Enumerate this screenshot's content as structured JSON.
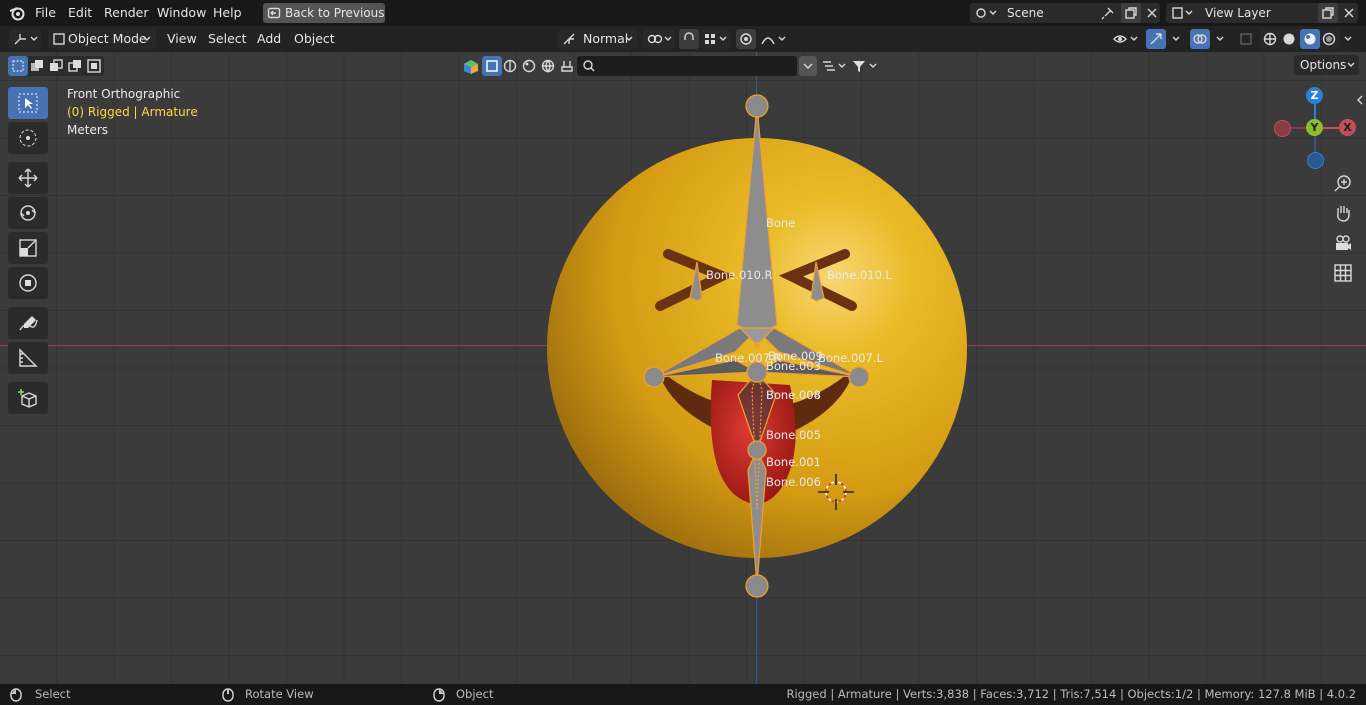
{
  "menu": {
    "file": "File",
    "edit": "Edit",
    "render": "Render",
    "window": "Window",
    "help": "Help",
    "back": "Back to Previous"
  },
  "scene": {
    "name": "Scene"
  },
  "view_layer": {
    "name": "View Layer"
  },
  "header": {
    "mode": "Object Mode",
    "view": "View",
    "select": "Select",
    "add": "Add",
    "object": "Object",
    "orientation": "Normal"
  },
  "overlay": {
    "view_name": "Front Orthographic",
    "collection": "(0) Rigged | Armature",
    "units": "Meters"
  },
  "options_label": "Options",
  "search": {
    "placeholder": ""
  },
  "bones": {
    "bone": "Bone",
    "b010r": "Bone.010.R",
    "b010l": "Bone.010.L",
    "b007r": "Bone.007.R",
    "b009": "Bone.009",
    "b003": "Bone.003",
    "b007l": "Bone.007.L",
    "b008": "Bone.008",
    "b004": "Bone.004",
    "b005": "Bone.005",
    "b001": "Bone.001",
    "b006": "Bone.006"
  },
  "gizmo": {
    "z": "Z",
    "y": "Y",
    "x": "X"
  },
  "status": {
    "select": "Select",
    "rotate": "Rotate View",
    "object": "Object",
    "stats": "Rigged | Armature | Verts:3,838 | Faces:3,712 | Tris:7,514 | Objects:1/2 | Memory: 127.8 MiB | 4.0.2"
  },
  "colors": {
    "accent": "#4772b3",
    "x_axis": "#c44d5b",
    "y_axis": "#8bbd2c",
    "z_axis": "#2e7fd6",
    "bone_select": "#f0a030",
    "emoji": "#e8b520"
  }
}
